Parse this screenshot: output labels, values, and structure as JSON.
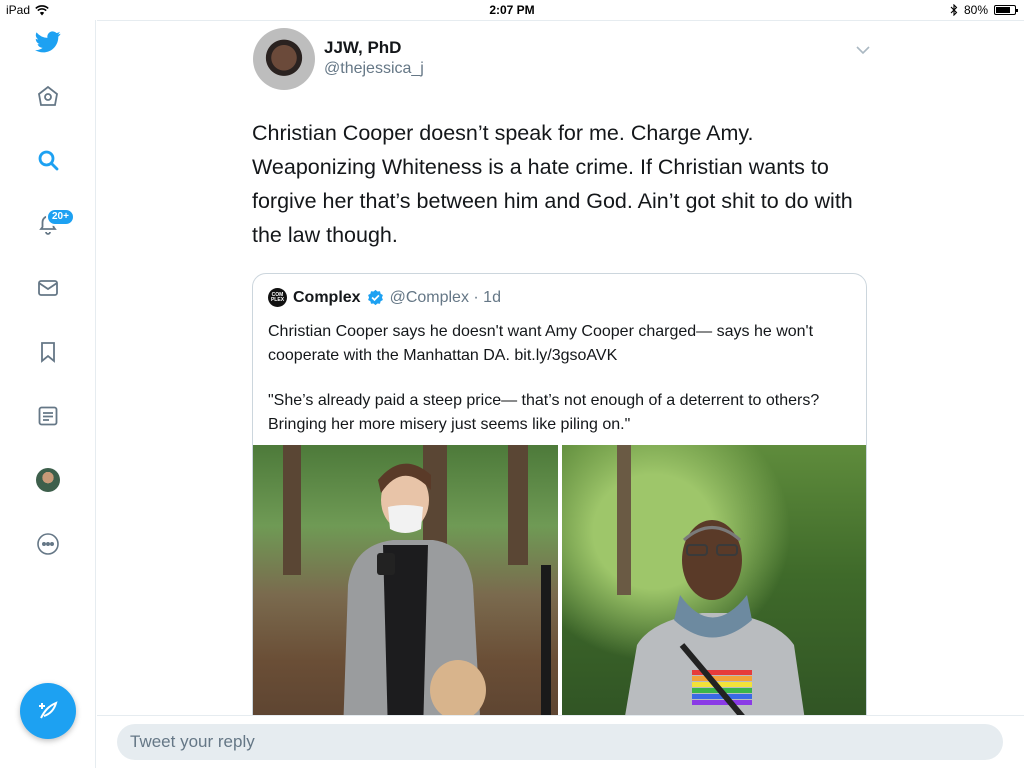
{
  "status_bar": {
    "device": "iPad",
    "time": "2:07 PM",
    "battery": "80%",
    "battery_level": 0.8
  },
  "sidebar": {
    "items": [
      {
        "icon": "twitter-logo-icon"
      },
      {
        "icon": "home-icon"
      },
      {
        "icon": "search-icon"
      },
      {
        "icon": "notifications-icon",
        "badge": "20+"
      },
      {
        "icon": "messages-icon"
      },
      {
        "icon": "bookmarks-icon"
      },
      {
        "icon": "lists-icon"
      },
      {
        "icon": "profile-avatar"
      },
      {
        "icon": "more-icon"
      }
    ],
    "compose_icon": "compose-tweet-icon"
  },
  "tweet": {
    "display_name": "JJW, PhD",
    "handle": "@thejessica_j",
    "text": "Christian Cooper doesn’t speak for me. Charge Amy. Weaponizing Whiteness is a hate crime. If Christian wants to forgive her that’s between him and God. Ain’t got shit to do with the law though."
  },
  "quoted_tweet": {
    "logo_text": "COM PLEX",
    "name": "Complex",
    "verified": true,
    "handle_time": "@Complex · 1d",
    "text_1": "Christian Cooper says he doesn't want Amy Cooper charged— says he won't cooperate with the Manhattan DA. bit.ly/3gsoAVK",
    "text_2": "\"She’s already paid a steep price— that’s not enough of a deterrent to others? Bringing her more misery just seems like piling on.\""
  },
  "reply": {
    "placeholder": "Tweet your reply"
  },
  "colors": {
    "accent": "#1da1f2",
    "text": "#14171a",
    "secondary": "#657786",
    "border": "#e6ecf0"
  }
}
